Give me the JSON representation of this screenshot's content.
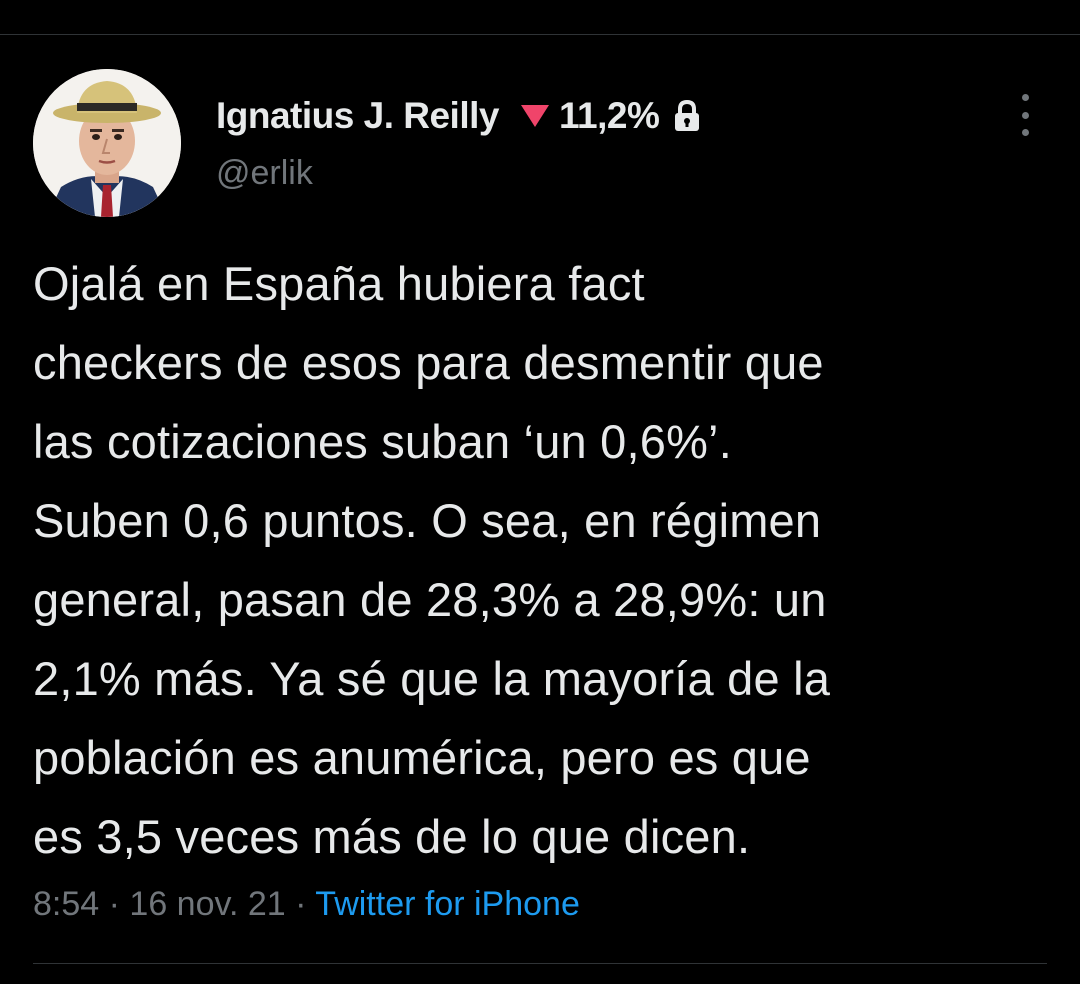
{
  "tweet": {
    "author": {
      "display_name": "Ignatius J. Reilly",
      "indicator_icon": "red-down-triangle-icon",
      "indicator_color": "#f0446a",
      "percentage": "11,2%",
      "protected_icon": "lock-icon",
      "handle": "@erlik",
      "avatar_icon": "man-in-hat-portrait"
    },
    "menu_icon": "more-vertical-icon",
    "text": "Ojalá en España hubiera fact\ncheckers de esos para desmentir que\nlas cotizaciones suban ‘un 0,6%’.\nSuben 0,6 puntos. O sea, en régimen\ngeneral, pasan de 28,3% a 28,9%: un\n2,1% más. Ya sé que la mayoría de la\npoblación es anumérica, pero es que\nes 3,5 veces más de lo que dicen.",
    "time": "8:54",
    "separator": " · ",
    "date": "16 nov. 21",
    "source": "Twitter for iPhone"
  },
  "colors": {
    "background": "#000000",
    "text_primary": "#e7e9ea",
    "text_secondary": "#71767b",
    "link": "#1d9bf0",
    "divider": "#2f3336"
  }
}
